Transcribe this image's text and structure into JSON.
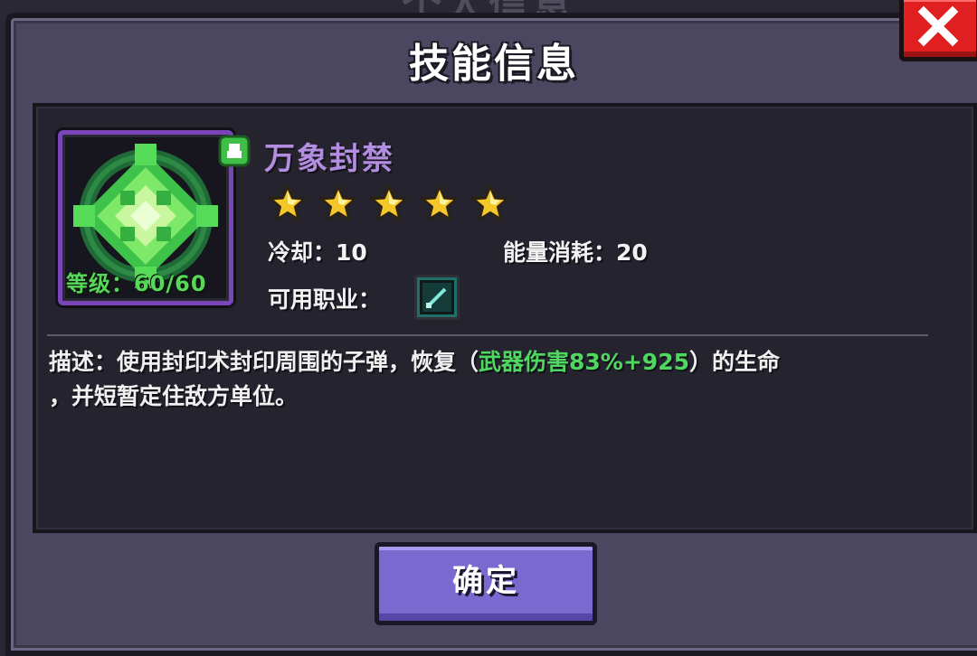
{
  "background": {
    "title": "个人信息"
  },
  "dialog": {
    "title": "技能信息",
    "close_icon": "close-icon",
    "confirm_label": "确定"
  },
  "skill": {
    "name": "万象封禁",
    "icon": "diamond-seal-skill-icon",
    "badge_icon": "green-gem-icon",
    "level_label": "等级：",
    "level_value": "60/60",
    "stars": 5,
    "cooldown_label": "冷却：",
    "cooldown_value": "10",
    "energy_label": "能量消耗：",
    "energy_value": "20",
    "class_label": "可用职业：",
    "class_icon": "sword-icon",
    "description": {
      "prefix": "描述：使用封印术封印周围的子弹，恢复（",
      "highlight": "武器伤害83%+925",
      "suffix_line1": "）的生命",
      "line2": "，并短暂定住敌方单位。"
    }
  },
  "colors": {
    "skill_name": "#b28de0",
    "highlight": "#4fd860",
    "level": "#58d85a",
    "close_button": "#e02020",
    "confirm_button": "#7a6ad0",
    "star": "#f5c628"
  }
}
